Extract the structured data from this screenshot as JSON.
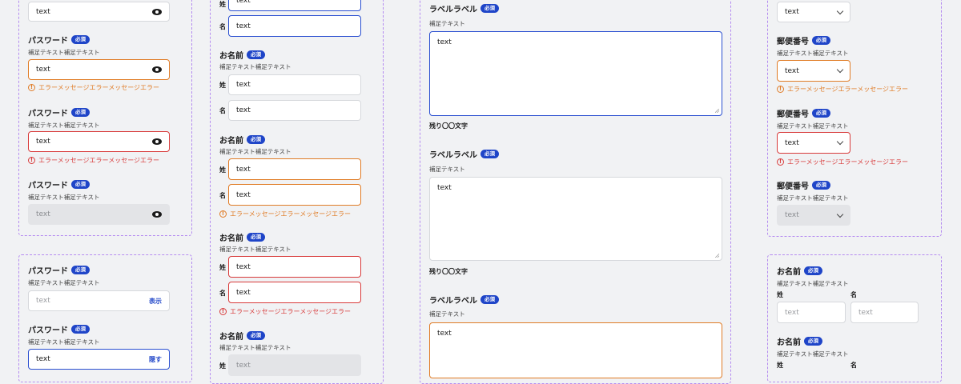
{
  "common": {
    "required_badge": "必須",
    "input_text": "text",
    "placeholder": "text",
    "hint_long": "補足テキスト補足テキスト",
    "hint_short": "補足テキスト",
    "warn_message": "エラーメッセージエラーメッセージエラー",
    "err_message": "エラーメッセージエラーメッセージエラー",
    "warn_icon": "!",
    "sei": "姓",
    "mei": "名"
  },
  "password": {
    "label": "パスワード",
    "show_label": "表示",
    "hide_label": "隠す"
  },
  "name": {
    "label": "お名前"
  },
  "textarea": {
    "label": "ラベルラベル",
    "count_label": "残り〇〇文字"
  },
  "postal": {
    "label": "郵便番号"
  },
  "colors": {
    "accent": "#1f45c8",
    "warning": "#e07b25",
    "error": "#d83a3a",
    "dashed_border": "#b58cf0"
  }
}
